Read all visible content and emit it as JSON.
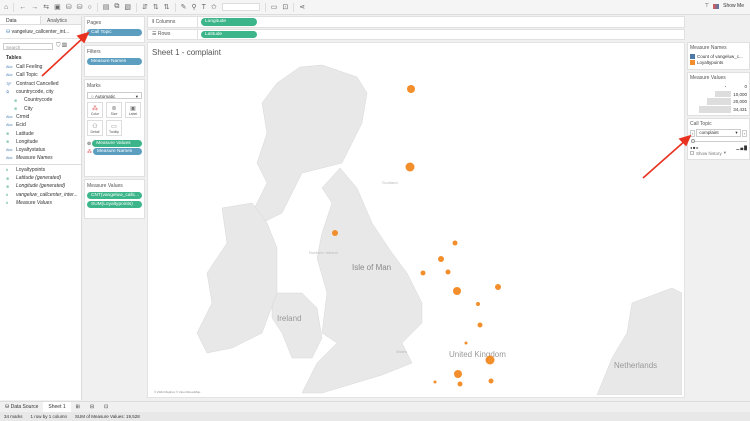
{
  "toolbar": {
    "show_me": "Show Me"
  },
  "data_pane": {
    "tab_data": "Data",
    "tab_analytics": "Analytics",
    "collapse": "<",
    "datasource": "vangeluw_callcenter_int...",
    "search_placeholder": "Search",
    "tables_heading": "Tables",
    "fields": [
      {
        "icon": "Abc",
        "name": "Call Feeling",
        "style": "normal"
      },
      {
        "icon": "Abc",
        "name": "Call Topic",
        "style": "normal"
      },
      {
        "icon": "T|F",
        "name": "Contract Cancelled",
        "style": "normal"
      },
      {
        "icon": "⛭",
        "name": "countrycode, city",
        "style": "normal"
      },
      {
        "icon": "⊕",
        "name": "Countrycode",
        "style": "sub"
      },
      {
        "icon": "⊕",
        "name": "City",
        "style": "sub"
      },
      {
        "icon": "Abc",
        "name": "Crmid",
        "style": "normal"
      },
      {
        "icon": "Abc",
        "name": "Ecid",
        "style": "normal"
      },
      {
        "icon": "⊕",
        "name": "Latitude",
        "style": "normal"
      },
      {
        "icon": "⊕",
        "name": "Longitude",
        "style": "normal"
      },
      {
        "icon": "Abc",
        "name": "Loyaltystatus",
        "style": "normal"
      },
      {
        "icon": "Abc",
        "name": "Measure Names",
        "style": "italic"
      },
      {
        "icon": "#",
        "name": "Loyaltypoints",
        "style": "measure"
      },
      {
        "icon": "⊕",
        "name": "Latitude (generated)",
        "style": "measure-italic"
      },
      {
        "icon": "⊕",
        "name": "Longitude (generated)",
        "style": "measure-italic"
      },
      {
        "icon": "#",
        "name": "vangeluw_callcenter_inter...",
        "style": "measure-italic"
      },
      {
        "icon": "#",
        "name": "Measure Values",
        "style": "measure-italic"
      }
    ]
  },
  "shelves": {
    "pages_label": "Pages",
    "pages_pill": "Call Topic",
    "filters_label": "Filters",
    "filters_pill": "Measure Names",
    "marks_label": "Marks",
    "mark_type": "Automatic",
    "mark_buttons": [
      "Color",
      "Size",
      "Label",
      "Detail",
      "Tooltip"
    ],
    "mark_pills": [
      "Measure Values",
      "Measure Names"
    ],
    "mv_label": "Measure Values",
    "mv_pills": [
      "CNT(vangeluw_callc...",
      "SUM(Loyaltypoints)"
    ],
    "columns_label": "Columns",
    "columns_pill": "Longitude",
    "rows_label": "Rows",
    "rows_pill": "Latitude"
  },
  "view": {
    "title": "Sheet 1 - complaint",
    "attribution": "© 2024 Mapbox © OpenStreetMap",
    "map_labels": [
      "Scotland",
      "Northern Ireland",
      "Isle of Man",
      "Ireland",
      "Wales",
      "United Kingdom",
      "Netherlands"
    ],
    "mark_color": "#f28e2b"
  },
  "legends": {
    "names_title": "Measure Names",
    "names": [
      {
        "label": "Count of vangeluw_c...",
        "color": "#4e79a7"
      },
      {
        "label": "Loyaltypoints",
        "color": "#f28e2b"
      }
    ],
    "values_title": "Measure Values",
    "sizes": [
      "0",
      "10,000",
      "20,000",
      "34,431"
    ],
    "page_title": "Call Topic",
    "page_value": "complaint",
    "show_history": "Show history"
  },
  "tabs": {
    "data_source": "Data Source",
    "sheet": "Sheet 1"
  },
  "status": {
    "marks": "34 marks",
    "dims": "1 row by 1 column",
    "sum": "SUM of Measure Values: 19,528"
  }
}
